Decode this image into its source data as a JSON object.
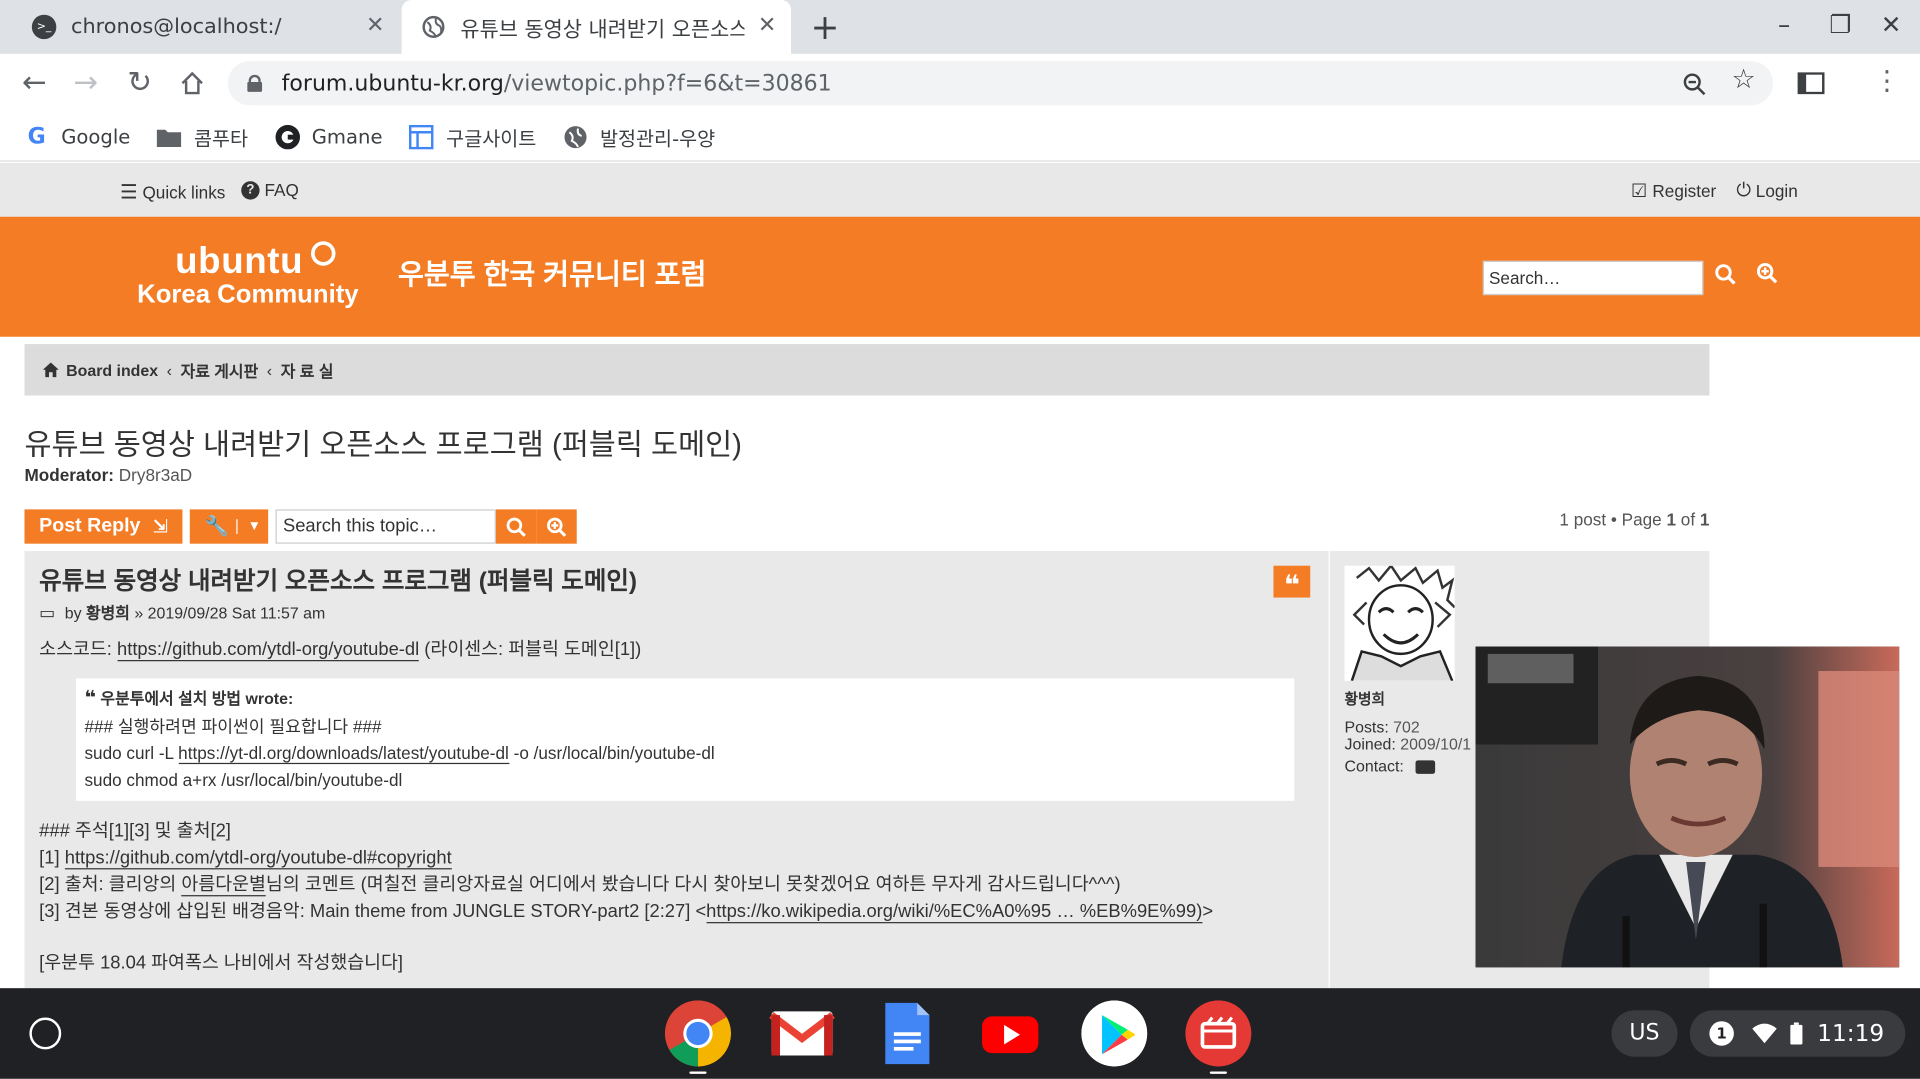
{
  "browser": {
    "tabs": [
      {
        "title": "chronos@localhost:/",
        "active": false
      },
      {
        "title": "유튜브 동영상 내려받기 오픈소스",
        "active": true
      }
    ],
    "new_tab": "+",
    "window_controls": {
      "minimize": "–",
      "restore": "❐",
      "close": "✕"
    },
    "url_host": "forum.ubuntu-kr.org",
    "url_path": "/viewtopic.php?f=6&t=30861",
    "bookmarks": [
      "Google",
      "콤푸타",
      "Gmane",
      "구글사이트",
      "발정관리-우양"
    ]
  },
  "forum": {
    "quick_links": "Quick links",
    "faq": "FAQ",
    "register": "Register",
    "login": "Login",
    "logo_top": "ubuntu",
    "logo_bottom": "Korea Community",
    "site_title": "우분투 한국 커뮤니티 포럼",
    "search_placeholder": "Search…",
    "breadcrumb": [
      "Board index",
      "자료 게시판",
      "자 료 실"
    ],
    "topic_title": "유튜브 동영상 내려받기 오픈소스 프로그램 (퍼블릭 도메인)",
    "moderator_label": "Moderator:",
    "moderator_name": "Dry8r3aD",
    "post_reply": "Post Reply",
    "topic_search_placeholder": "Search this topic…",
    "pagination": {
      "posts": "1 post",
      "page_label": "Page",
      "page": "1",
      "of": "of",
      "total": "1"
    }
  },
  "post": {
    "title": "유튜브 동영상 내려받기 오픈소스 프로그램 (퍼블릭 도메인)",
    "by": "by",
    "author": "황병희",
    "date": "» 2019/09/28 Sat 11:57 am",
    "source_label": "소스코드:",
    "source_url": "https://github.com/ytdl-org/youtube-dl",
    "license": "(라이센스: 퍼블릭 도메인[1])",
    "quote_cite": "우분투에서 설치 방법 wrote:",
    "quote_line1": "### 실행하려면 파이썬이 필요합니다 ###",
    "quote_line2_pre": "sudo curl -L",
    "quote_line2_url": "https://yt-dl.org/downloads/latest/youtube-dl",
    "quote_line2_post": "-o /usr/local/bin/youtube-dl",
    "quote_line3": "sudo chmod a+rx /usr/local/bin/youtube-dl",
    "notes_header": "### 주석[1][3] 및 출처[2]",
    "note1_pre": "[1]",
    "note1_url": "https://github.com/ytdl-org/youtube-dl#copyright",
    "note2_pre": "[2] 출처: 클리앙의",
    "note2_link": "아름다운별",
    "note2_post": "님의 코멘트 (며칠전 클리앙자료실 어디에서 봤습니다 다시 찾아보니 못찾겠어요 여하튼 무자게 감사드립니다^^^)",
    "note3_pre": "[3] 견본 동영상에 삽입된 배경음악: Main theme from JUNGLE STORY-part2 [2:27] <",
    "note3_url": "https://ko.wikipedia.org/wiki/%EC%A0%95 … %EB%9E%99)",
    "note3_post": ">",
    "footer_line": "[우분투 18.04 파여폭스 나비에서 작성했습니다]"
  },
  "profile": {
    "name": "황병희",
    "posts_label": "Posts:",
    "posts": "702",
    "joined_label": "Joined:",
    "joined": "2009/10/1",
    "contact_label": "Contact:"
  },
  "shelf": {
    "apps": [
      "chrome",
      "gmail",
      "docs",
      "youtube",
      "play-store",
      "screen-recorder"
    ],
    "ime": "US",
    "notification_count": "1",
    "time": "11:19"
  },
  "colors": {
    "accent": "#f37c25",
    "shelf": "#202124",
    "tabstrip": "#dee1e6"
  }
}
